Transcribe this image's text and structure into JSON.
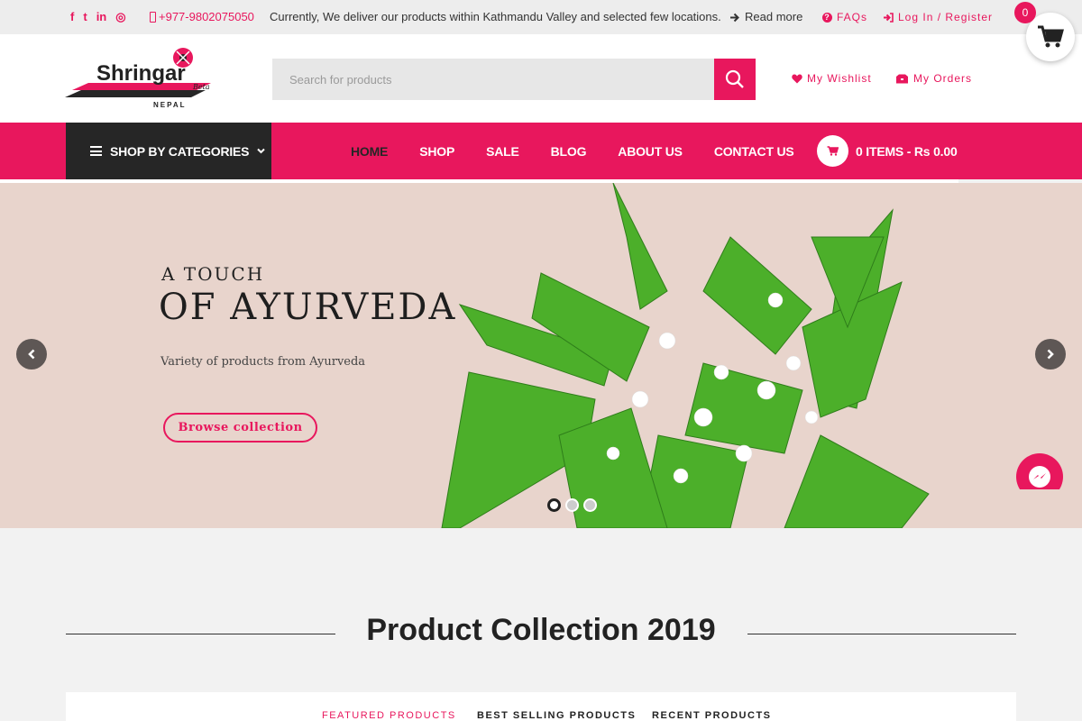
{
  "topbar": {
    "social_icons": [
      "facebook-icon",
      "twitter-icon",
      "linkedin-icon",
      "instagram-icon"
    ],
    "social_glyphs": [
      "f",
      "t",
      "in",
      "◎"
    ],
    "phone": "+977-9802075050",
    "notice": "Currently, We deliver our products within Kathmandu Valley and selected few locations.",
    "read_more": "Read more",
    "faqs": "FAQs",
    "login": "Log In / Register"
  },
  "floating_cart": {
    "count": "0"
  },
  "header": {
    "logo_text": "Shringar",
    "logo_beta": "Beta",
    "logo_sub": "NEPAL",
    "search_placeholder": "Search for products",
    "wishlist": "My Wishlist",
    "orders": "My Orders"
  },
  "nav": {
    "categories": "SHOP BY CATEGORIES",
    "items": [
      "HOME",
      "SHOP",
      "SALE",
      "BLOG",
      "ABOUT US",
      "CONTACT US"
    ],
    "active": "HOME",
    "cart": "0 ITEMS - Rs 0.00"
  },
  "hero": {
    "subtitle": "A TOUCH",
    "title": "OF AYURVEDA",
    "description": "Variety of products from Ayurveda",
    "button": "Browse collection",
    "slides": 3,
    "active_slide": 1
  },
  "section": {
    "title": "Product Collection 2019",
    "tabs": [
      "FEATURED PRODUCTS",
      "BEST SELLING PRODUCTS",
      "RECENT PRODUCTS"
    ],
    "active_tab": "FEATURED PRODUCTS"
  },
  "colors": {
    "accent": "#e8175d",
    "dark": "#262626",
    "hero_bg": "#e8d4cc",
    "leaf": "#4caf2a"
  }
}
